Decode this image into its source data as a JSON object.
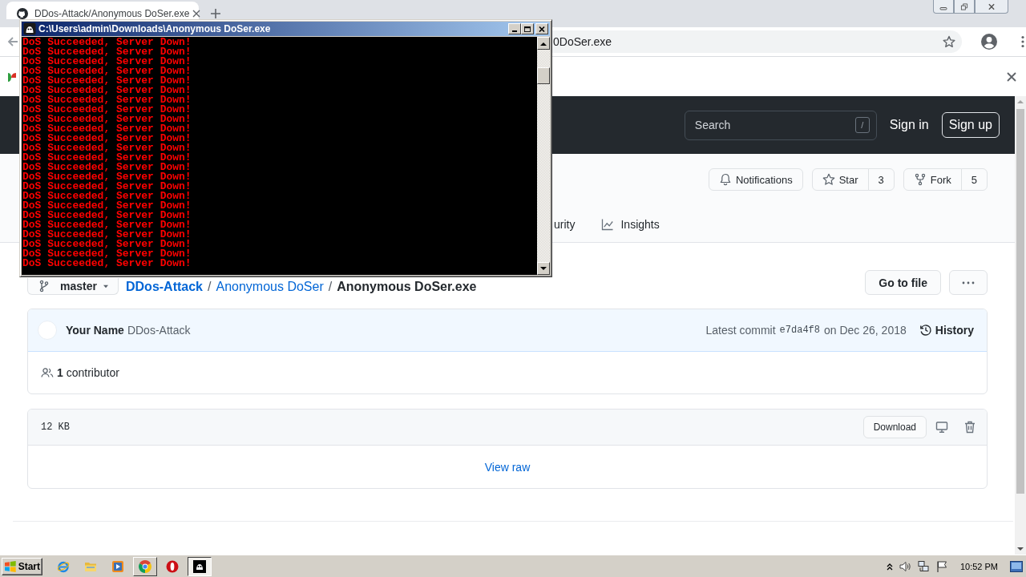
{
  "browser": {
    "tab_title": "DDos-Attack/Anonymous DoSer.exe",
    "url": "0DoSer.exe"
  },
  "site_header": {
    "search_placeholder": "Search",
    "search_key": "/",
    "sign_in": "Sign in",
    "sign_up": "Sign up"
  },
  "repo_actions": [
    {
      "kind": "notifications",
      "label": "Notifications"
    },
    {
      "kind": "star",
      "label": "Star",
      "count": "3"
    },
    {
      "kind": "fork",
      "label": "Fork",
      "count": "5"
    }
  ],
  "repo_tabs": [
    {
      "kind": "plain",
      "label": "urity"
    },
    {
      "kind": "graph",
      "label": "Insights"
    }
  ],
  "file_nav": {
    "branch": "master",
    "path": [
      {
        "kind": "link",
        "text": "DDos-Attack"
      },
      {
        "kind": "sep",
        "text": "/"
      },
      {
        "kind": "folder",
        "text": "Anonymous DoSer"
      },
      {
        "kind": "sep",
        "text": "/"
      },
      {
        "kind": "file",
        "text": "Anonymous DoSer.exe"
      }
    ],
    "go_to_file": "Go to file"
  },
  "commit": {
    "author": "Your Name",
    "message": "DDos-Attack",
    "prefix": "Latest commit",
    "sha": "e7da4f8",
    "date": "on Dec 26, 2018",
    "history": "History",
    "contributors": "**1** contributor"
  },
  "file": {
    "size": "12 KB",
    "download": "Download",
    "view_raw": "View raw"
  },
  "console": {
    "title": "C:\\Users\\admin\\Downloads\\Anonymous DoSer.exe",
    "lines": [
      "DoS Succeeded, Server Down!",
      "DoS Succeeded, Server Down!",
      "DoS Succeeded, Server Down!",
      "DoS Succeeded, Server Down!",
      "DoS Succeeded, Server Down!",
      "DoS Succeeded, Server Down!",
      "DoS Succeeded, Server Down!",
      "DoS Succeeded, Server Down!",
      "DoS Succeeded, Server Down!",
      "DoS Succeeded, Server Down!",
      "DoS Succeeded, Server Down!",
      "DoS Succeeded, Server Down!",
      "DoS Succeeded, Server Down!",
      "DoS Succeeded, Server Down!",
      "DoS Succeeded, Server Down!",
      "DoS Succeeded, Server Down!",
      "DoS Succeeded, Server Down!",
      "DoS Succeeded, Server Down!",
      "DoS Succeeded, Server Down!",
      "DoS Succeeded, Server Down!",
      "DoS Succeeded, Server Down!",
      "DoS Succeeded, Server Down!",
      "DoS Succeeded, Server Down!",
      "DoS Succeeded, Server Down!"
    ]
  },
  "taskbar": {
    "start": "Start",
    "apps": [
      {
        "kind": "ie",
        "open": false,
        "selected": false
      },
      {
        "kind": "folder",
        "open": false,
        "selected": false
      },
      {
        "kind": "media",
        "open": false,
        "selected": false
      },
      {
        "kind": "chrome",
        "open": true,
        "selected": false
      },
      {
        "kind": "opera",
        "open": false,
        "selected": false
      },
      {
        "kind": "console",
        "open": true,
        "selected": true
      }
    ],
    "clock": "10:52 PM"
  }
}
